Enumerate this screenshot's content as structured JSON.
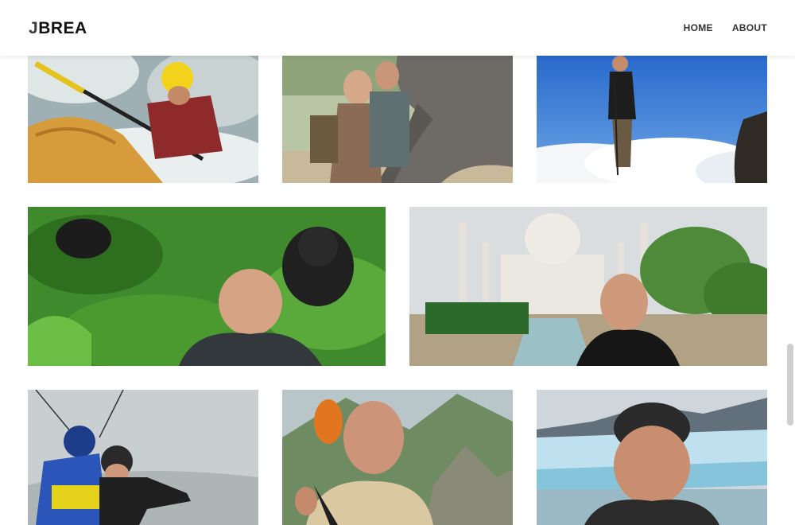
{
  "header": {
    "logo_first": "J",
    "logo_rest": "BREA",
    "nav": [
      {
        "label": "HOME"
      },
      {
        "label": "ABOUT"
      }
    ]
  },
  "gallery": {
    "photos": [
      {
        "subject": "kayaking whitewater"
      },
      {
        "subject": "couple with elephant"
      },
      {
        "subject": "hiker above clouds"
      },
      {
        "subject": "selfie with gorillas"
      },
      {
        "subject": "selfie at Taj Mahal"
      },
      {
        "subject": "paragliding tandem"
      },
      {
        "subject": "selfie at Machu Picchu"
      },
      {
        "subject": "selfie at glacier"
      }
    ]
  }
}
